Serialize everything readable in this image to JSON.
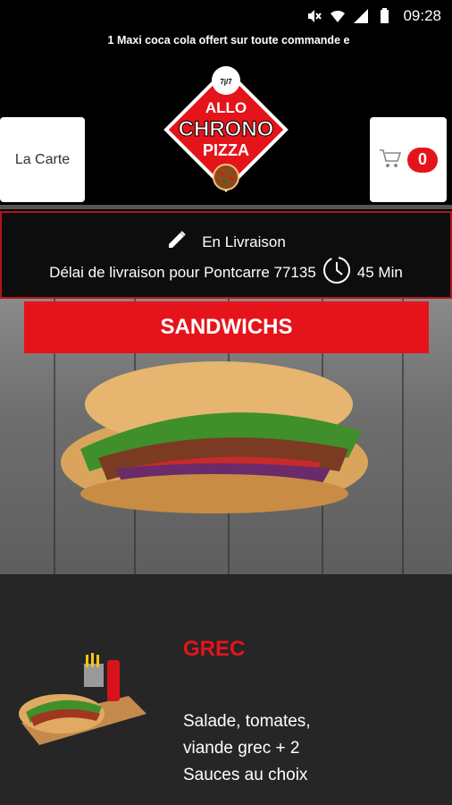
{
  "status_bar": {
    "time": "09:28",
    "icons": [
      "mute-icon",
      "wifi-icon",
      "signal-icon",
      "battery-icon"
    ]
  },
  "marquee": {
    "text": "1 Maxi coca cola offert sur toute commande e"
  },
  "header": {
    "menu_label": "La Carte",
    "cart_count": "0",
    "logo_text": [
      "ALLO",
      "CHRONO",
      "PIZZA"
    ],
    "logo_number": "7j/7"
  },
  "delivery": {
    "mode": "En Livraison",
    "delay_label": "Délai de livraison pour Pontcarre 77135",
    "delay_value": "45 Min"
  },
  "category": {
    "title": "SANDWICHS"
  },
  "product": {
    "title": "GREC",
    "description": "Salade, tomates, viande grec + 2 Sauces au choix"
  },
  "colors": {
    "accent": "#e5141b",
    "background": "#000000",
    "panel": "#262626"
  }
}
